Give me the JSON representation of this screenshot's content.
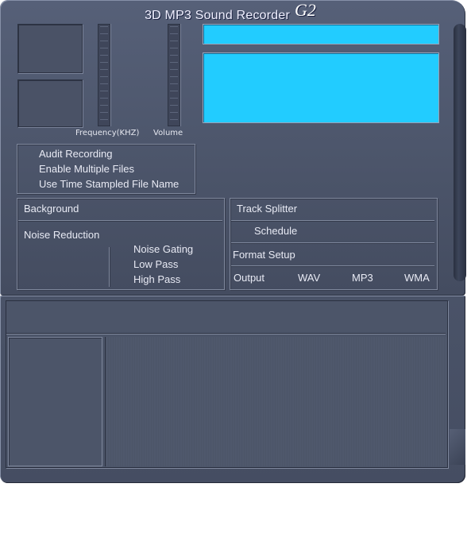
{
  "app": {
    "title": "3D MP3 Sound Recorder",
    "version": "G2"
  },
  "meters": {
    "frequency_label": "Frequency(KHZ)",
    "volume_label": "Volume"
  },
  "options": [
    "Audit Recording",
    "Enable Multiple Files",
    "Use Time Stampled File Name"
  ],
  "background_panel": {
    "header": "Background",
    "noise_reduction": "Noise Reduction",
    "filters": [
      "Noise Gating",
      "Low Pass",
      "High Pass"
    ]
  },
  "track_panel": {
    "track_splitter": "Track Splitter",
    "schedule": "Schedule",
    "format_setup": "Format Setup",
    "output_label": "Output",
    "formats": [
      "WAV",
      "MP3",
      "WMA"
    ]
  },
  "colors": {
    "lcd": "#22ccff",
    "chassis": "#4b5469",
    "text": "#e8eaf4"
  }
}
